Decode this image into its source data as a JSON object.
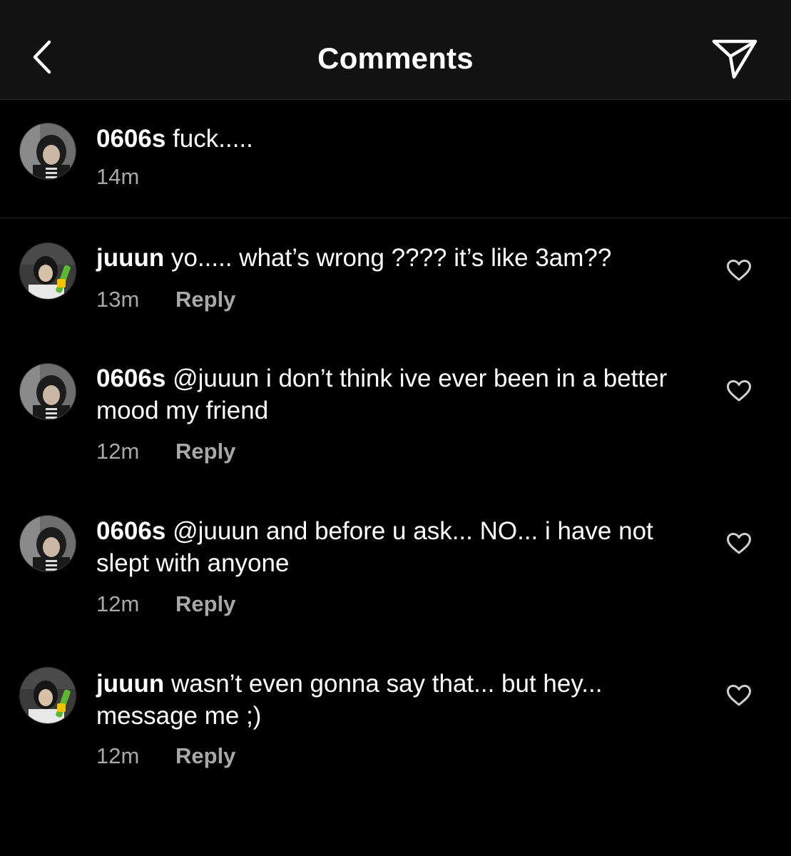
{
  "header": {
    "title": "Comments",
    "back_icon": "chevron-left-icon",
    "send_icon": "paper-plane-icon"
  },
  "caption": {
    "username": "0606s",
    "text": "fuck.....",
    "time": "14m"
  },
  "comments": [
    {
      "username": "juuun",
      "text": "yo..... what’s wrong ???? it’s like 3am??",
      "time": "13m",
      "reply_label": "Reply"
    },
    {
      "username": "0606s",
      "text": "@juuun i don’t think ive ever been in a better mood my friend",
      "time": "12m",
      "reply_label": "Reply"
    },
    {
      "username": "0606s",
      "text": "@juuun and before u ask... NO... i have not slept with anyone",
      "time": "12m",
      "reply_label": "Reply"
    },
    {
      "username": "juuun",
      "text": "wasn’t even gonna say that... but hey... message me ;)",
      "time": "12m",
      "reply_label": "Reply"
    }
  ],
  "colors": {
    "background": "#000000",
    "header_background": "#121212",
    "text": "#ffffff",
    "secondary_text": "#a8a8a8",
    "divider": "#262626"
  }
}
